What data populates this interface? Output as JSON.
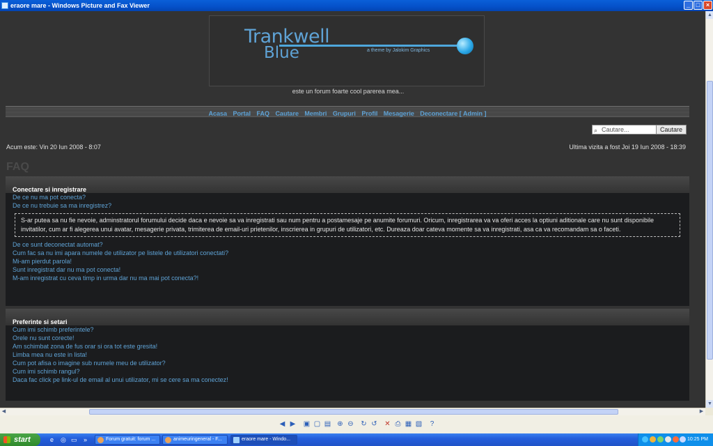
{
  "window": {
    "title": "eraore mare - Windows Picture and Fax Viewer"
  },
  "forum": {
    "logo_line1": "Trankwell",
    "logo_line2": "Blue",
    "logo_subtitle": "a theme by Jalokim Graphics",
    "tagline": "este un forum foarte cool parerea mea...",
    "nav": [
      "Acasa",
      "Portal",
      "FAQ",
      "Cautare",
      "Membri",
      "Grupuri",
      "Profil",
      "Mesagerie",
      "Deconectare [ Admin ]"
    ],
    "search": {
      "placeholder": "Cautare...",
      "button": "Cautare"
    },
    "now": "Acum este: Vin 20 Iun 2008 - 8:07",
    "last_visit": "Ultima vizita a fost Joi 19 Iun 2008 - 18:39",
    "faq_title": "FAQ",
    "sections": [
      {
        "title": "Conectare si inregistrare",
        "links_before": [
          "De ce nu ma pot conecta?",
          "De ce nu trebuie sa ma inregistrez?"
        ],
        "answer": "S-ar putea sa nu fie nevoie, adminstratorul forumului decide daca e nevoie sa va inregistrati sau num pentru a postamesaje pe anumite forumuri. Oricum, inregistrarea va va oferi acces la optiuni aditionale care nu sunt disponibile invitatilor, cum ar fi alegerea unui avatar, mesagerie privata, trimiterea de email-uri prietenilor, inscrierea in grupuri de utilizatori, etc. Dureaza doar cateva momente sa va inregistrati, asa ca va recomandam sa o faceti.",
        "links_after": [
          "De ce sunt deconectat automat?",
          "Cum fac sa nu imi apara numele de utilizator pe listele de utilizatori conectati?",
          "Mi-am pierdut parola!",
          "Sunt inregistrat dar nu ma pot conecta!",
          "M-am inregistrat cu ceva timp in urma dar nu ma mai pot conecta?!"
        ]
      },
      {
        "title": "Preferinte si setari",
        "links": [
          "Cum imi schimb preferintele?",
          "Orele nu sunt corecte!",
          "Am schimbat zona de fus orar si ora tot este gresita!",
          "Limba mea nu este in lista!",
          "Cum pot afisa o imagine sub numele meu de utilizator?",
          "Cum imi schimb rangul?",
          "Daca fac click pe link-ul de email al unui utilizator, mi se cere sa ma conectez!"
        ]
      }
    ]
  },
  "taskbar": {
    "start": "start",
    "tasks": [
      "Forum gratuit: forum ...",
      "animeuringeneral - F...",
      "eraore mare - Windo..."
    ],
    "clock": "10:25 PM"
  }
}
